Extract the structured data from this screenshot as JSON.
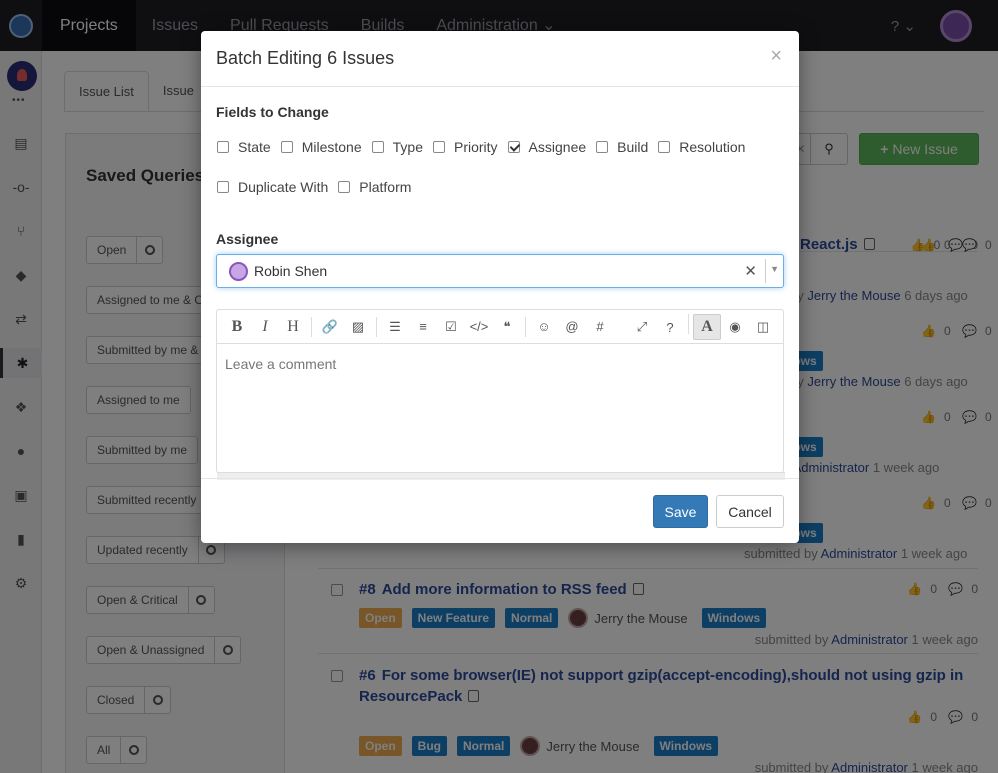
{
  "topnav": {
    "tabs": [
      "Projects",
      "Issues",
      "Pull Requests",
      "Builds",
      "Administration ⌄"
    ],
    "help_label": "? ⌄"
  },
  "sidebar": {
    "dots": "•••",
    "icons": [
      "document-icon",
      "commit-icon",
      "branch-icon",
      "tag-icon",
      "pull-request-icon",
      "bug-icon",
      "builds-icon",
      "chat-icon",
      "code-comment-icon",
      "stats-icon",
      "gear-icon"
    ]
  },
  "background": {
    "tabs": [
      "Issue List",
      "Issue"
    ],
    "saved_queries_title": "Saved Queries",
    "queries": [
      "Open",
      "Assigned to me & O",
      "Submitted by me &",
      "Assigned to me",
      "Submitted by me",
      "Submitted recently",
      "Updated recently",
      "Open & Critical",
      "Open & Unassigned",
      "Closed",
      "All"
    ],
    "new_issue_label": "New Issue",
    "issues": [
      {
        "title_fragment": "React.js",
        "submitted_by": "Jerry the Mouse",
        "when": "6 days ago",
        "votes": "0",
        "comments": "0"
      },
      {
        "title_fragment": "",
        "label": "lows",
        "submitted_by": "Jerry the Mouse",
        "when": "6 days ago",
        "votes": "0",
        "comments": "0"
      },
      {
        "title_fragment": "",
        "label": "lows",
        "submitted_by": "Administrator",
        "when": "1 week ago",
        "votes": "0",
        "comments": "0"
      },
      {
        "title_fragment": "",
        "label": "lows",
        "submitted_by": "Administrator",
        "when": "1 week ago",
        "votes": "0",
        "comments": "0"
      },
      {
        "num": "#8",
        "title": "Add more information to RSS feed",
        "state": "Open",
        "type": "New Feature",
        "priority": "Normal",
        "assignee": "Jerry the Mouse",
        "platform": "Windows",
        "submitted_by": "Administrator",
        "when": "1 week ago",
        "votes": "0",
        "comments": "0"
      },
      {
        "num": "#6",
        "title": "For some browser(IE) not support gzip(accept-encoding),should not using gzip in ResourcePack",
        "state": "Open",
        "type": "Bug",
        "priority": "Normal",
        "assignee": "Jerry the Mouse",
        "platform": "Windows",
        "submitted_by": "Administrator",
        "when": "1 week ago",
        "votes": "0",
        "comments": "0"
      }
    ],
    "submitted_prefix": "submitted by",
    "submitted_prefix_short": "by"
  },
  "modal": {
    "title": "Batch Editing 6 Issues",
    "close": "×",
    "fields_label": "Fields to Change",
    "fields_row1": [
      {
        "label": "State",
        "checked": false
      },
      {
        "label": "Milestone",
        "checked": false
      },
      {
        "label": "Type",
        "checked": false
      },
      {
        "label": "Priority",
        "checked": false
      },
      {
        "label": "Assignee",
        "checked": true
      },
      {
        "label": "Build",
        "checked": false
      },
      {
        "label": "Resolution",
        "checked": false
      }
    ],
    "fields_row2": [
      {
        "label": "Duplicate With",
        "checked": false
      },
      {
        "label": "Platform",
        "checked": false
      }
    ],
    "assignee_label": "Assignee",
    "assignee_value": "Robin Shen",
    "comment_placeholder": "Leave a comment",
    "save_label": "Save",
    "cancel_label": "Cancel"
  }
}
